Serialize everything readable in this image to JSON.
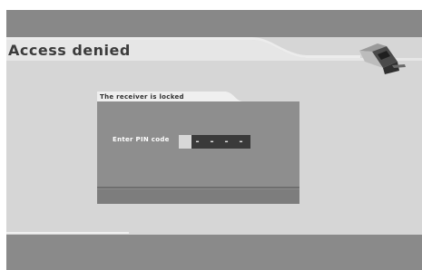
{
  "screen": {
    "title": "Access denied",
    "logo_icon": "receiver-logo-icon"
  },
  "dialog": {
    "title": "The receiver is locked",
    "pin_label": "Enter PIN code",
    "pin_digits": [
      "-",
      "-",
      "-",
      "-"
    ]
  },
  "colors": {
    "background": "#d6d6d6",
    "bar": "#888888",
    "dialog": "#8e8e8e",
    "pin_field": "#3a3a3a"
  }
}
